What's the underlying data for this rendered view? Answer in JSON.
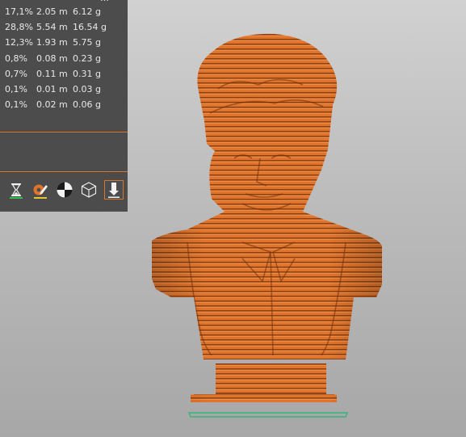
{
  "stats": {
    "partial_row": "…",
    "rows": [
      {
        "percent": "17,1%",
        "length": "2.05 m",
        "weight": "6.12 g"
      },
      {
        "percent": "28,8%",
        "length": "5.54 m",
        "weight": "16.54 g"
      },
      {
        "percent": "12,3%",
        "length": "1.93 m",
        "weight": "5.75 g"
      },
      {
        "percent": "0,8%",
        "length": "0.08 m",
        "weight": "0.23 g"
      },
      {
        "percent": "0,7%",
        "length": "0.11 m",
        "weight": "0.31 g"
      },
      {
        "percent": "0,1%",
        "length": "0.01 m",
        "weight": "0.03 g"
      },
      {
        "percent": "0,1%",
        "length": "0.02 m",
        "weight": "0.06 g"
      }
    ]
  },
  "toolbar": {
    "buttons": [
      {
        "icon": "hourglass-icon"
      },
      {
        "icon": "filament-color-icon"
      },
      {
        "icon": "color-print-icon"
      },
      {
        "icon": "cube-wireframe-icon"
      },
      {
        "icon": "export-gcode-icon"
      }
    ]
  },
  "colors": {
    "panel_bg": "#4c4c4c",
    "accent": "#d5752a",
    "model_orange": "#e0742c",
    "bed_outline": "#35b47a"
  }
}
